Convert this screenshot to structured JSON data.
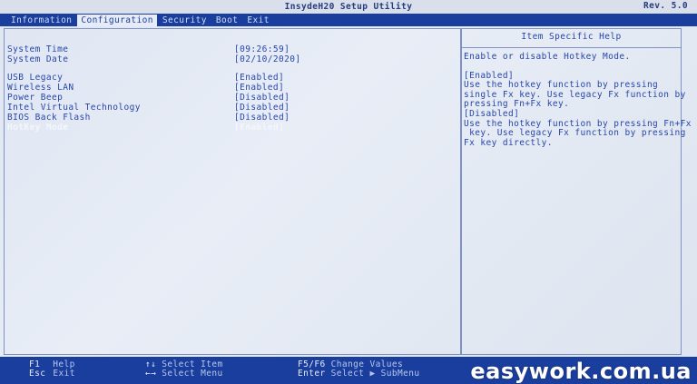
{
  "titlebar": {
    "title": "InsydeH20 Setup Utility",
    "revision": "Rev. 5.0"
  },
  "menu": {
    "items": [
      {
        "label": "Information",
        "active": false
      },
      {
        "label": "Configuration",
        "active": true
      },
      {
        "label": "Security",
        "active": false
      },
      {
        "label": "Boot",
        "active": false
      },
      {
        "label": "Exit",
        "active": false
      }
    ]
  },
  "settings": {
    "system_time": {
      "label": "System Time",
      "value": "[09:26:59]"
    },
    "system_date": {
      "label": "System Date",
      "value": "[02/10/2020]"
    },
    "usb_legacy": {
      "label": "USB Legacy",
      "value": "[Enabled]"
    },
    "wireless_lan": {
      "label": "Wireless LAN",
      "value": "[Enabled]"
    },
    "power_beep": {
      "label": "Power Beep",
      "value": "[Disabled]"
    },
    "intel_vt": {
      "label": "Intel Virtual Technology",
      "value": "[Disabled]"
    },
    "bios_back_flash": {
      "label": "BIOS Back Flash",
      "value": "[Disabled]"
    },
    "hotkey_mode": {
      "label": "HotKey Mode",
      "value": "[Enabled]",
      "selected": true
    }
  },
  "help": {
    "header": "Item Specific Help",
    "summary": "Enable or disable Hotkey Mode.",
    "enabled_label": "[Enabled]",
    "enabled_lines": [
      "Use the hotkey function by pressing",
      "single Fx key. Use legacy Fx function by",
      "pressing Fn+Fx key."
    ],
    "disabled_label": "[Disabled]",
    "disabled_lines": [
      "Use the hotkey function by pressing Fn+Fx",
      " key. Use legacy Fx function by pressing",
      "Fx key directly."
    ]
  },
  "footer": {
    "f1": {
      "key": "F1",
      "desc": "Help"
    },
    "esc": {
      "key": "Esc",
      "desc": "Exit"
    },
    "updown": {
      "key": "↑↓",
      "desc": "Select Item"
    },
    "leftright": {
      "key": "←→",
      "desc": "Select Menu"
    },
    "f5f6": {
      "key": "F5/F6",
      "desc": "Change Values"
    },
    "enter": {
      "key": "Enter",
      "desc": "Select ▶ SubMenu"
    }
  },
  "watermark": "easywork.com.ua",
  "colors": {
    "screen_bg": "#e3e9f3",
    "bar_blue": "#1a3e9e",
    "text_blue": "#2746a8",
    "selected_text": "#f4f6fb"
  }
}
